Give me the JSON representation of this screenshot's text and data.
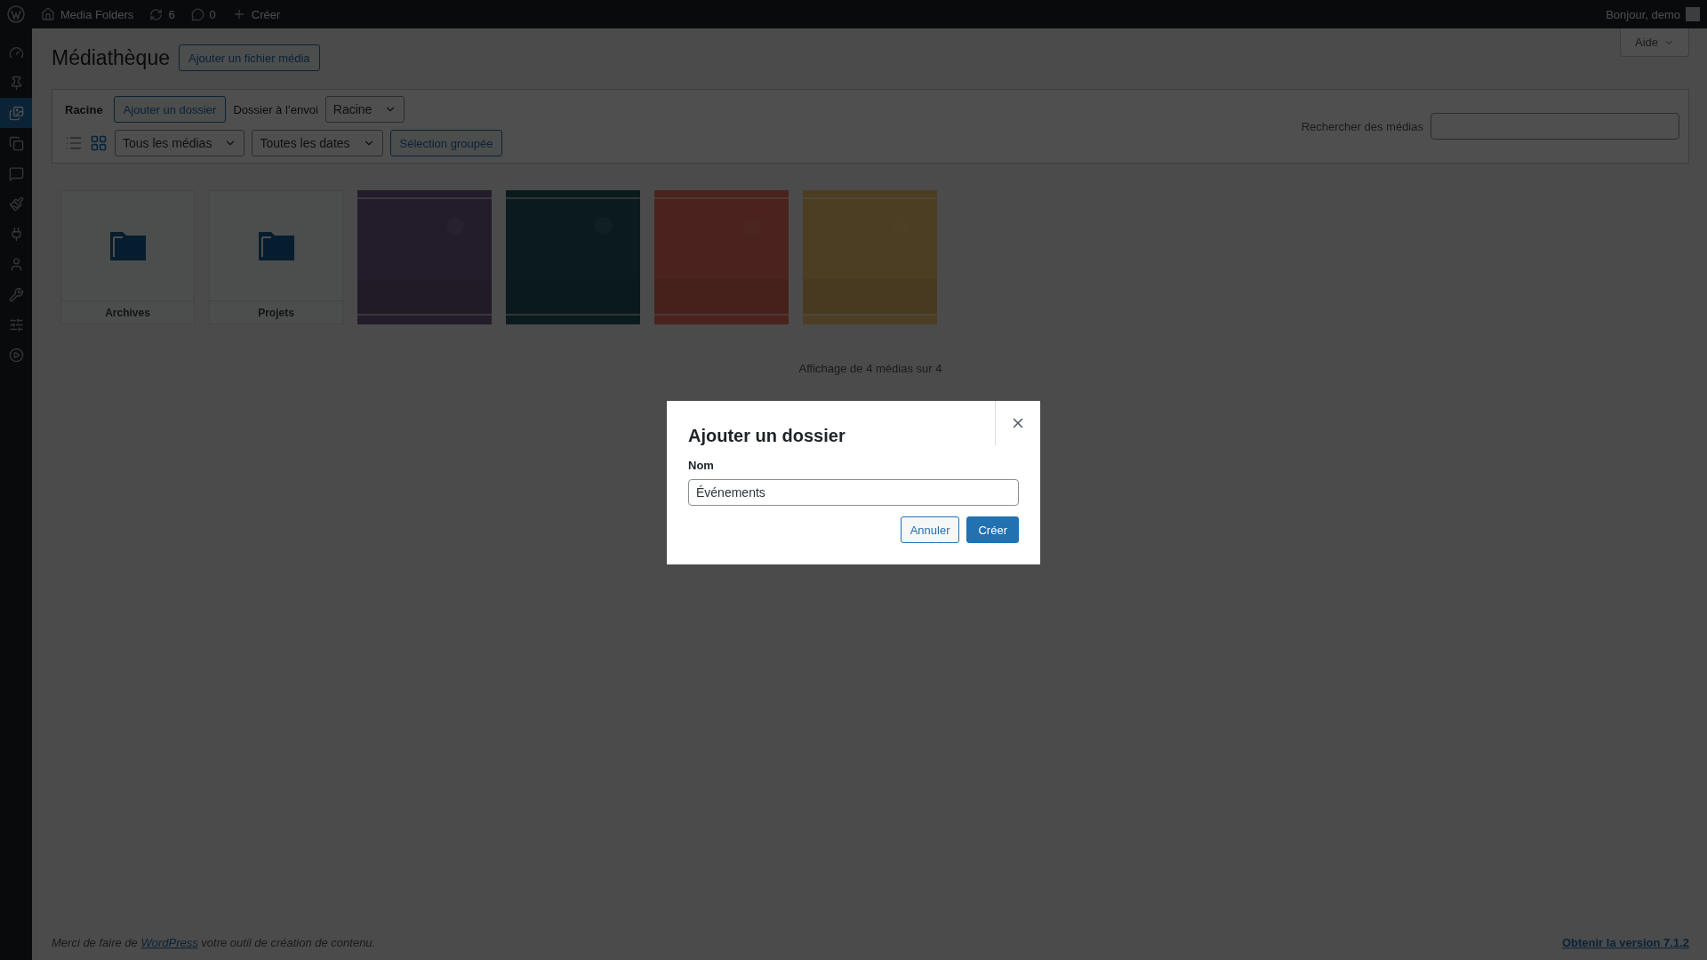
{
  "admin_bar": {
    "site": "Media Folders",
    "updates": "6",
    "comments": "0",
    "new": "Créer",
    "greeting": "Bonjour, demo"
  },
  "sidebar": {
    "items": [
      {
        "selected": false
      },
      {
        "selected": false
      },
      {
        "selected": true
      },
      {
        "selected": false
      },
      {
        "selected": false
      },
      {
        "selected": false
      },
      {
        "selected": false
      },
      {
        "selected": false
      },
      {
        "selected": false
      },
      {
        "selected": false
      },
      {
        "selected": false
      }
    ]
  },
  "help_button": "Aide",
  "page": {
    "title": "Médiathèque",
    "add_button": "Ajouter un fichier média"
  },
  "toolbar": {
    "folder_label": "Racine",
    "add_folder_button": "Ajouter un dossier",
    "upload_folder_label": "Dossier à l’envoi",
    "upload_folder_select": "Racine",
    "view_modes": [
      {
        "selected": false
      },
      {
        "selected": true
      }
    ],
    "type_filter": "Tous les médias",
    "date_filter": "Toutes les dates",
    "bulk_button": "Sélection groupée",
    "search_label": "Rechercher des médias"
  },
  "items": [
    {
      "kind": "folder",
      "name": "Archives"
    },
    {
      "kind": "folder",
      "name": "Projets"
    },
    {
      "kind": "picture"
    },
    {
      "kind": "picture"
    },
    {
      "kind": "picture"
    },
    {
      "kind": "picture"
    }
  ],
  "count": "Affichage de 4 médias sur 4",
  "dialog": {
    "title": "Ajouter un dossier",
    "field_label": "Nom",
    "field_value": "Événements",
    "cancel": "Annuler",
    "confirm": "Créer"
  },
  "footer": {
    "before": "Merci de faire de ",
    "link": "WordPress",
    "after": " votre outil de création de contenu.",
    "version_link": "Obtenir la version 7.1.2"
  }
}
